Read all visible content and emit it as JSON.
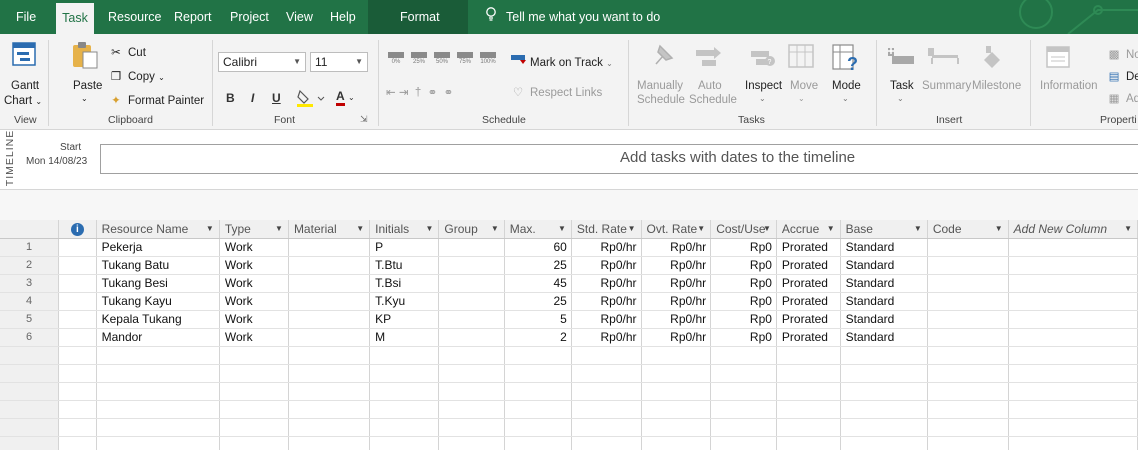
{
  "menu": {
    "tabs": [
      "File",
      "Task",
      "Resource",
      "Report",
      "Project",
      "View",
      "Help",
      "Format"
    ],
    "tell_me": "Tell me what you want to do"
  },
  "ribbon": {
    "view": {
      "gantt_label": "Gantt",
      "chart_label": "Chart",
      "group": "View"
    },
    "clipboard": {
      "paste": "Paste",
      "cut": "Cut",
      "copy": "Copy",
      "format_painter": "Format Painter",
      "group": "Clipboard"
    },
    "font": {
      "family": "Calibri",
      "size": "11",
      "bold": "B",
      "italic": "I",
      "underline": "U",
      "font_color": "A",
      "group": "Font"
    },
    "schedule": {
      "pct_labels": [
        "0%",
        "25%",
        "50%",
        "75%",
        "100%"
      ],
      "mark_on_track": "Mark on Track",
      "respect_links": "Respect Links",
      "group": "Schedule"
    },
    "tasks": {
      "manually": "Manually",
      "schedule1": "Schedule",
      "auto": "Auto",
      "schedule2": "Schedule",
      "inspect": "Inspect",
      "move": "Move",
      "mode": "Mode",
      "group": "Tasks"
    },
    "insert": {
      "task": "Task",
      "summary": "Summary",
      "milestone": "Milestone",
      "group": "Insert"
    },
    "properties": {
      "information": "Information",
      "notes": "No",
      "details": "De",
      "add": "Ad",
      "group": "Properti"
    }
  },
  "timeline": {
    "side_label": "TIMELINE",
    "start_label": "Start",
    "start_date": "Mon 14/08/23",
    "message": "Add tasks with dates to the timeline"
  },
  "sheet": {
    "columns": [
      "Resource Name",
      "Type",
      "Material",
      "Initials",
      "Group",
      "Max.",
      "Std. Rate",
      "Ovt. Rate",
      "Cost/Use",
      "Accrue",
      "Base",
      "Code",
      "Add New Column"
    ],
    "rows": [
      {
        "no": "1",
        "name": "Pekerja",
        "type": "Work",
        "material": "",
        "initials": "P",
        "group": "",
        "max": "60",
        "std": "Rp0/hr",
        "ovt": "Rp0/hr",
        "cost": "Rp0",
        "accrue": "Prorated",
        "base": "Standard",
        "code": ""
      },
      {
        "no": "2",
        "name": "Tukang Batu",
        "type": "Work",
        "material": "",
        "initials": "T.Btu",
        "group": "",
        "max": "25",
        "std": "Rp0/hr",
        "ovt": "Rp0/hr",
        "cost": "Rp0",
        "accrue": "Prorated",
        "base": "Standard",
        "code": ""
      },
      {
        "no": "3",
        "name": "Tukang Besi",
        "type": "Work",
        "material": "",
        "initials": "T.Bsi",
        "group": "",
        "max": "45",
        "std": "Rp0/hr",
        "ovt": "Rp0/hr",
        "cost": "Rp0",
        "accrue": "Prorated",
        "base": "Standard",
        "code": ""
      },
      {
        "no": "4",
        "name": "Tukang Kayu",
        "type": "Work",
        "material": "",
        "initials": "T.Kyu",
        "group": "",
        "max": "25",
        "std": "Rp0/hr",
        "ovt": "Rp0/hr",
        "cost": "Rp0",
        "accrue": "Prorated",
        "base": "Standard",
        "code": ""
      },
      {
        "no": "5",
        "name": "Kepala Tukang",
        "type": "Work",
        "material": "",
        "initials": "KP",
        "group": "",
        "max": "5",
        "std": "Rp0/hr",
        "ovt": "Rp0/hr",
        "cost": "Rp0",
        "accrue": "Prorated",
        "base": "Standard",
        "code": ""
      },
      {
        "no": "6",
        "name": "Mandor",
        "type": "Work",
        "material": "",
        "initials": "M",
        "group": "",
        "max": "2",
        "std": "Rp0/hr",
        "ovt": "Rp0/hr",
        "cost": "Rp0",
        "accrue": "Prorated",
        "base": "Standard",
        "code": ""
      }
    ]
  },
  "colors": {
    "brand": "#217346",
    "brand_dark": "#1a5c38",
    "ribbon_bg": "#f3f3f3",
    "info_icon": "#2b6cb0"
  }
}
